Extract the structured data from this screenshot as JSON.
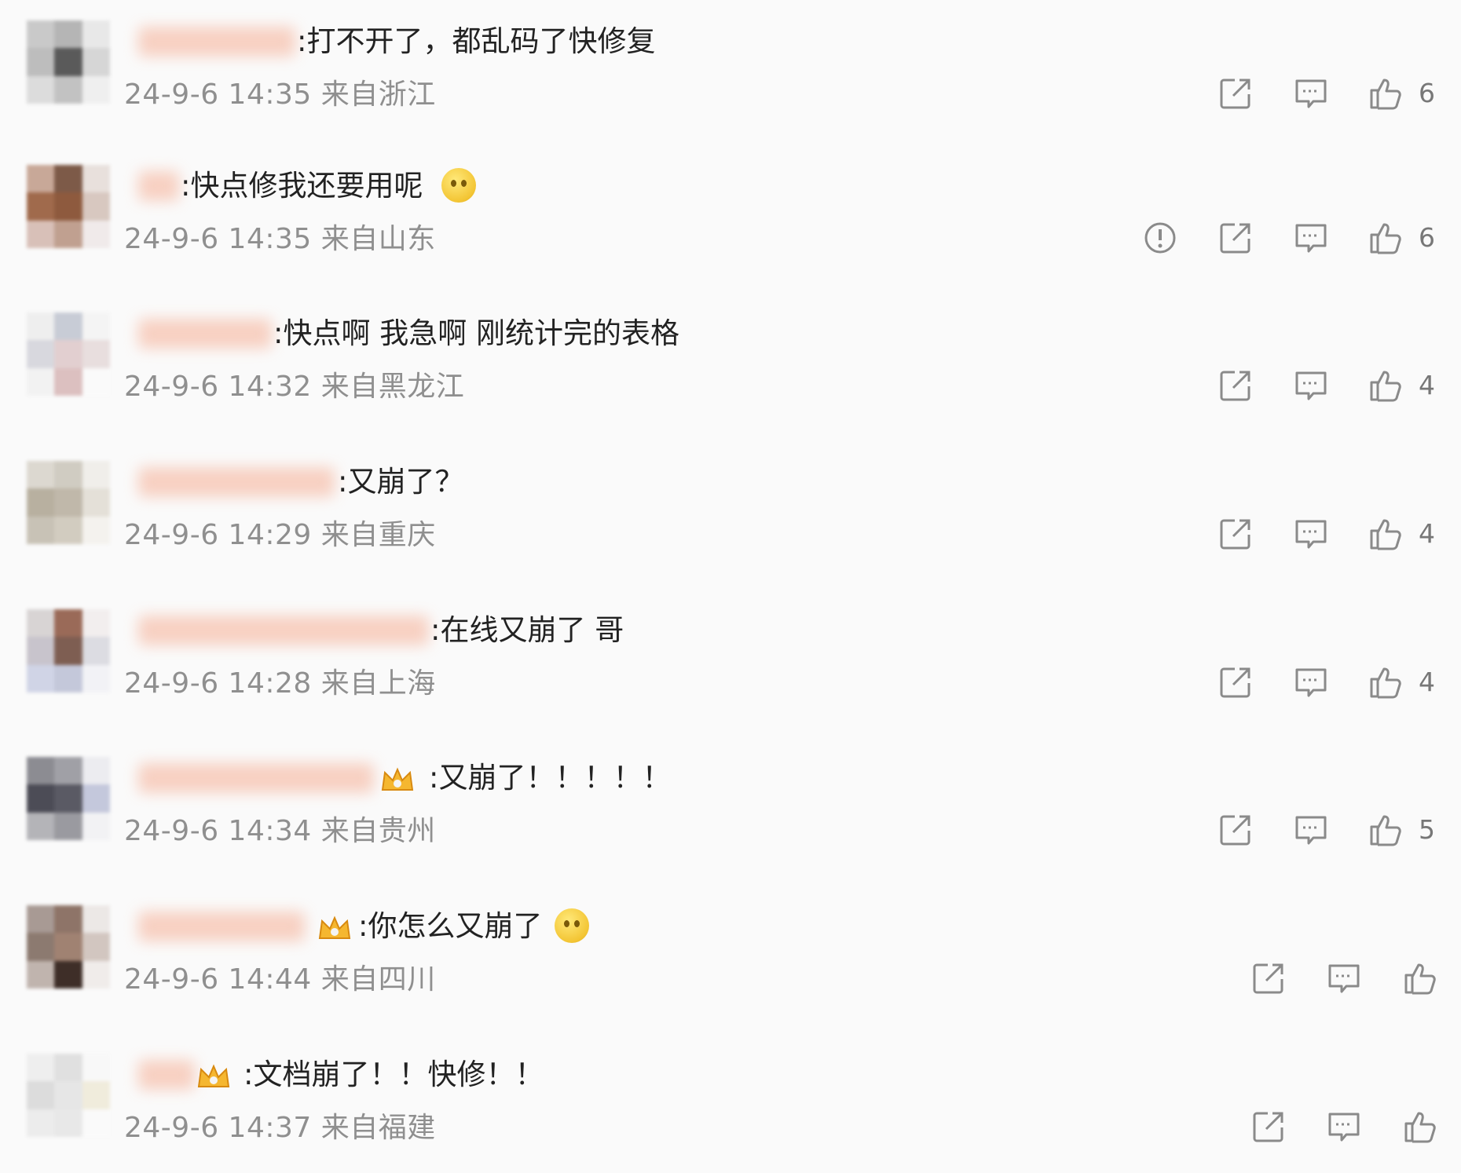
{
  "comments": [
    {
      "text": ":打不开了，都乱码了快修复",
      "meta": "24-9-6 14:35 来自浙江",
      "likes": "6"
    },
    {
      "text": ":快点修我还要用呢",
      "meta": "24-9-6 14:35 来自山东",
      "likes": "6"
    },
    {
      "text": ":快点啊  我急啊 刚统计完的表格",
      "meta": "24-9-6 14:32 来自黑龙江",
      "likes": "4"
    },
    {
      "text": ":又崩了？",
      "meta": "24-9-6 14:29 来自重庆",
      "likes": "4"
    },
    {
      "text": ":在线又崩了 哥",
      "meta": "24-9-6 14:28 来自上海",
      "likes": "4"
    },
    {
      "text": ":又崩了！！！！！",
      "meta": "24-9-6 14:34 来自贵州",
      "likes": "5"
    },
    {
      "text": ":你怎么又崩了",
      "meta": "24-9-6 14:44 来自四川",
      "likes": ""
    },
    {
      "text": ":文档崩了！！快修！！",
      "meta": "24-9-6 14:37 来自福建",
      "likes": ""
    }
  ],
  "icons": {
    "share": "share-icon",
    "reply": "comment-icon",
    "like": "thumbs-up-icon",
    "report": "report-icon",
    "crown": "crown-badge-icon",
    "emoji": "emoji-icon"
  },
  "colors": {
    "background": "#fafafa",
    "comment_text": "#222222",
    "meta_text": "#8f8f8f",
    "icon": "#8a8a8a"
  }
}
